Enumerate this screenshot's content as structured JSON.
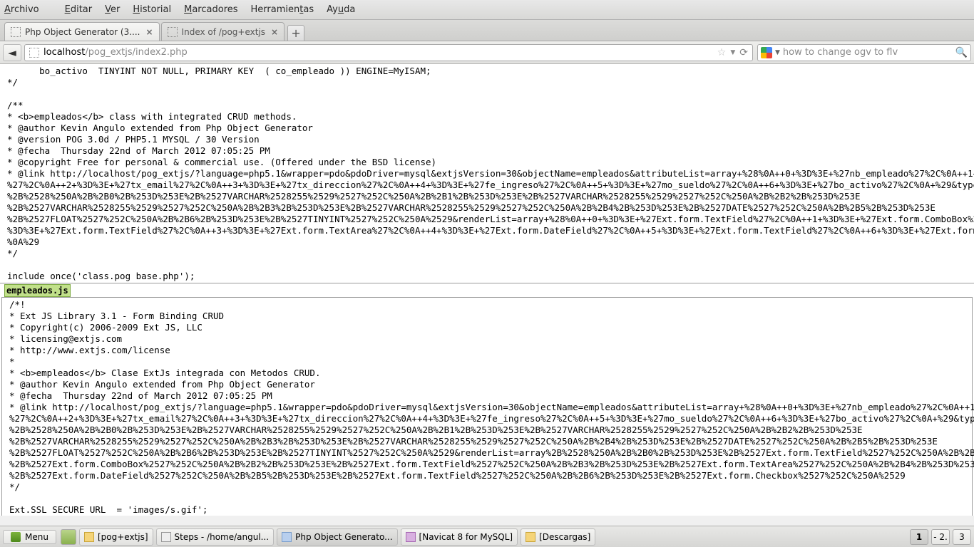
{
  "menubar": {
    "archivo": "Archivo",
    "editar": "Editar",
    "ver": "Ver",
    "historial": "Historial",
    "marcadores": "Marcadores",
    "herramientas": "Herramientas",
    "ayuda": "Ayuda"
  },
  "tabs": [
    {
      "label": "Php Object Generator (3....",
      "active": true
    },
    {
      "label": "Index of /pog+extjs",
      "active": false
    }
  ],
  "url": {
    "host": "localhost",
    "path": "/pog_extjs/index2.php"
  },
  "search": {
    "placeholder": "how to change ogv to flv"
  },
  "code_top": "      bo_activo  TINYINT NOT NULL, PRIMARY KEY  ( co_empleado )) ENGINE=MyISAM;\n*/\n\n/**\n* <b>empleados</b> class with integrated CRUD methods.\n* @author Kevin Angulo extended from Php Object Generator\n* @version POG 3.0d / PHP5.1 MYSQL / 30 Version\n* @fecha  Thursday 22nd of March 2012 07:05:25 PM\n* @copyright Free for personal & commercial use. (Offered under the BSD license)\n* @link http://localhost/pog_extjs/?language=php5.1&wrapper=pdo&pdoDriver=mysql&extjsVersion=30&objectName=empleados&attributeList=array+%28%0A++0+%3D%3E+%27nb_empleado%27%2C%0A++1+%\n%27%2C%0A++2+%3D%3E+%27tx_email%27%2C%0A++3+%3D%3E+%27tx_direccion%27%2C%0A++4+%3D%3E+%27fe_ingreso%27%2C%0A++5+%3D%3E+%27mo_sueldo%27%2C%0A++6+%3D%3E+%27bo_activo%27%2C%0A+%29&typeL\n%2B%2528%250A%2B%2B0%2B%253D%253E%2B%2527VARCHAR%2528255%2529%2527%252C%250A%2B%2B1%2B%253D%253E%2B%2527VARCHAR%2528255%2529%2527%252C%250A%2B%2B2%2B%253D%253E\n%2B%2527VARCHAR%2528255%2529%2527%252C%250A%2B%2B3%2B%253D%253E%2B%2527VARCHAR%2528255%2529%2527%252C%250A%2B%2B4%2B%253D%253E%2B%2527DATE%2527%252C%250A%2B%2B5%2B%253D%253E\n%2B%2527FLOAT%2527%252C%250A%2B%2B6%2B%253D%253E%2B%2527TINYINT%2527%252C%250A%2529&renderList=array+%28%0A++0+%3D%3E+%27Ext.form.TextField%27%2C%0A++1+%3D%3E+%27Ext.form.ComboBox%2\n%3D%3E+%27Ext.form.TextField%27%2C%0A++3+%3D%3E+%27Ext.form.TextArea%27%2C%0A++4+%3D%3E+%27Ext.form.DateField%27%2C%0A++5+%3D%3E+%27Ext.form.TextField%27%2C%0A++6+%3D%3E+%27Ext.form\n%0A%29\n*/\n\ninclude once('class.pog base.php');",
  "section_header": "empleados.js",
  "code_bottom": "/*!\n* Ext JS Library 3.1 - Form Binding CRUD\n* Copyright(c) 2006-2009 Ext JS, LLC\n* licensing@extjs.com\n* http://www.extjs.com/license\n*\n* <b>empleados</b> Clase ExtJs integrada con Metodos CRUD.\n* @author Kevin Angulo extended from Php Object Generator\n* @fecha  Thursday 22nd of March 2012 07:05:25 PM\n* @link http://localhost/pog_extjs/?language=php5.1&wrapper=pdo&pdoDriver=mysql&extjsVersion=30&objectName=empleados&attributeList=array+%28%0A++0+%3D%3E+%27nb_empleado%27%2C%0A++1+%\n%27%2C%0A++2+%3D%3E+%27tx_email%27%2C%0A++3+%3D%3E+%27tx_direccion%27%2C%0A++4+%3D%3E+%27fe_ingreso%27%2C%0A++5+%3D%3E+%27mo_sueldo%27%2C%0A++6+%3D%3E+%27bo_activo%27%2C%0A+%29&typeL\n%2B%2528%250A%2B%2B0%2B%253D%253E%2B%2527VARCHAR%2528255%2529%2527%252C%250A%2B%2B1%2B%253D%253E%2B%2527VARCHAR%2528255%2529%2527%252C%250A%2B%2B2%2B%253D%253E\n%2B%2527VARCHAR%2528255%2529%2527%252C%250A%2B%2B3%2B%253D%253E%2B%2527VARCHAR%2528255%2529%2527%252C%250A%2B%2B4%2B%253D%253E%2B%2527DATE%2527%252C%250A%2B%2B5%2B%253D%253E\n%2B%2527FLOAT%2527%252C%250A%2B%2B6%2B%253D%253E%2B%2527TINYINT%2527%252C%250A%2529&renderList=array%2B%2528%250A%2B%2B0%2B%253D%253E%2B%2527Ext.form.TextField%2527%252C%250A%2B%2B1\n%2B%2527Ext.form.ComboBox%2527%252C%250A%2B%2B2%2B%253D%253E%2B%2527Ext.form.TextField%2527%252C%250A%2B%2B3%2B%253D%253E%2B%2527Ext.form.TextArea%2527%252C%250A%2B%2B4%2B%253D%253E\n%2B%2527Ext.form.DateField%2527%252C%250A%2B%2B5%2B%253D%253E%2B%2527Ext.form.TextField%2527%252C%250A%2B%2B6%2B%253D%253E%2B%2527Ext.form.Checkbox%2527%252C%250A%2529\n*/\n\nExt.SSL SECURE URL  = 'images/s.gif';",
  "taskbar": {
    "menu": "Menu",
    "items": [
      {
        "label": "[pog+extjs]",
        "icon": "folder"
      },
      {
        "label": "Steps - /home/angul...",
        "icon": "text"
      },
      {
        "label": "Php Object Generato...",
        "icon": "web",
        "active": true
      },
      {
        "label": "[Navicat 8 for MySQL]",
        "icon": "db"
      },
      {
        "label": "[Descargas]",
        "icon": "folder"
      }
    ],
    "workspaces": [
      "1",
      "- 2.",
      "3"
    ],
    "active_ws": 0
  }
}
